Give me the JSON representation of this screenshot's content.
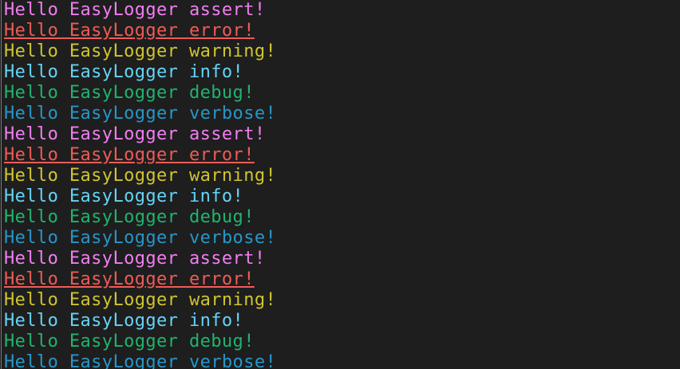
{
  "terminal": {
    "lines": [
      {
        "level": "assert",
        "text": "Hello EasyLogger assert!"
      },
      {
        "level": "error",
        "text": "Hello EasyLogger error!"
      },
      {
        "level": "warning",
        "text": "Hello EasyLogger warning!"
      },
      {
        "level": "info",
        "text": "Hello EasyLogger info!"
      },
      {
        "level": "debug",
        "text": "Hello EasyLogger debug!"
      },
      {
        "level": "verbose",
        "text": "Hello EasyLogger verbose!"
      },
      {
        "level": "assert",
        "text": "Hello EasyLogger assert!"
      },
      {
        "level": "error",
        "text": "Hello EasyLogger error!"
      },
      {
        "level": "warning",
        "text": "Hello EasyLogger warning!"
      },
      {
        "level": "info",
        "text": "Hello EasyLogger info!"
      },
      {
        "level": "debug",
        "text": "Hello EasyLogger debug!"
      },
      {
        "level": "verbose",
        "text": "Hello EasyLogger verbose!"
      },
      {
        "level": "assert",
        "text": "Hello EasyLogger assert!"
      },
      {
        "level": "error",
        "text": "Hello EasyLogger error!"
      },
      {
        "level": "warning",
        "text": "Hello EasyLogger warning!"
      },
      {
        "level": "info",
        "text": "Hello EasyLogger info!"
      },
      {
        "level": "debug",
        "text": "Hello EasyLogger debug!"
      },
      {
        "level": "verbose",
        "text": "Hello EasyLogger verbose!"
      }
    ]
  },
  "colors": {
    "background": "#1e1e1e",
    "assert": "#f07ef0",
    "error": "#ef5b57",
    "warning": "#cfc52e",
    "info": "#64d4f5",
    "debug": "#1fb46e",
    "verbose": "#2696c9"
  }
}
